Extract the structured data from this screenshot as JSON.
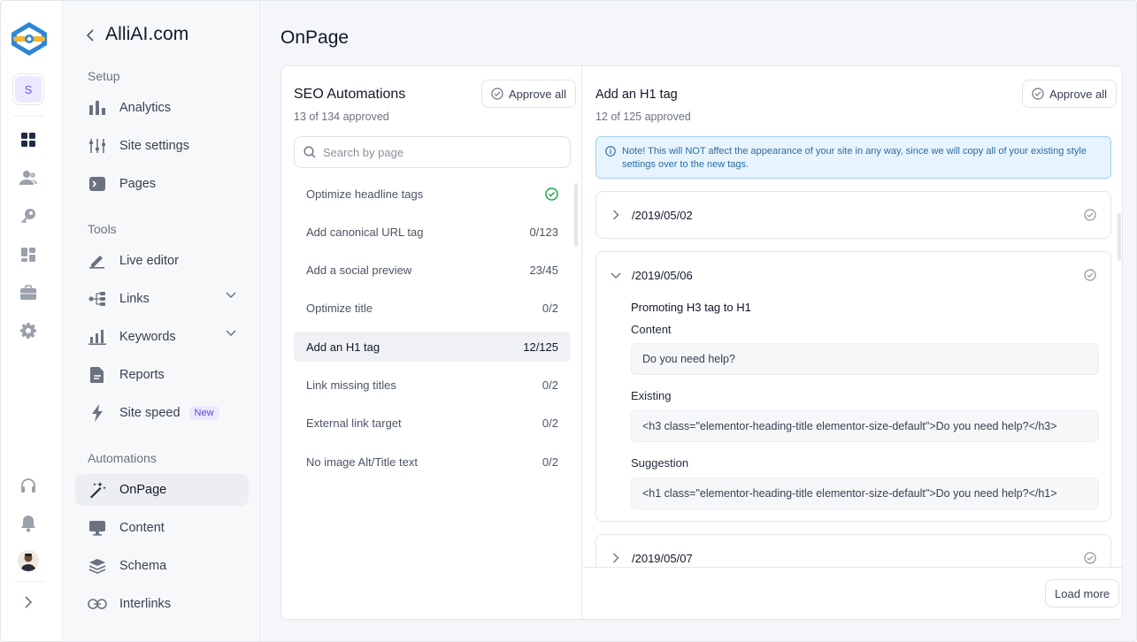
{
  "rail": {
    "site_initial": "S",
    "icons": [
      "dashboard-icon",
      "users-icon",
      "key-icon",
      "widgets-icon",
      "briefcase-icon",
      "gear-icon",
      "headphones-icon",
      "bell-icon",
      "avatar",
      "expand-icon"
    ]
  },
  "sidebar": {
    "title": "AlliAI.com",
    "sections": {
      "setup": "Setup",
      "tools": "Tools",
      "automations": "Automations"
    },
    "items": {
      "analytics": "Analytics",
      "site_settings": "Site settings",
      "pages": "Pages",
      "live_editor": "Live editor",
      "links": "Links",
      "keywords": "Keywords",
      "reports": "Reports",
      "site_speed": "Site speed",
      "site_speed_badge": "New",
      "onpage": "OnPage",
      "content": "Content",
      "schema": "Schema",
      "interlinks": "Interlinks"
    }
  },
  "main": {
    "title": "OnPage"
  },
  "left_pane": {
    "title": "SEO Automations",
    "subtitle": "13 of 134 approved",
    "approve_label": "Approve all",
    "search_placeholder": "Search by page",
    "automations": [
      {
        "label": "Optimize headline tags",
        "count": "",
        "done": true
      },
      {
        "label": "Add canonical URL tag",
        "count": "0/123"
      },
      {
        "label": "Add a social preview",
        "count": "23/45"
      },
      {
        "label": "Optimize title",
        "count": "0/2"
      },
      {
        "label": "Add an H1 tag",
        "count": "12/125",
        "active": true
      },
      {
        "label": "Link missing titles",
        "count": "0/2"
      },
      {
        "label": "External link target",
        "count": "0/2"
      },
      {
        "label": "No image Alt/Title text",
        "count": "0/2"
      }
    ]
  },
  "right_pane": {
    "title": "Add an H1 tag",
    "subtitle": "12 of 125 approved",
    "approve_label": "Approve all",
    "note": "Note! This will NOT affect the appearance of your site in any way, since we will copy all of your existing style settings over to the new tags.",
    "entries": [
      {
        "path": "/2019/05/02"
      },
      {
        "path": "/2019/05/06",
        "heading": "Promoting H3 tag to H1",
        "content_label": "Content",
        "content_value": "Do you need help?",
        "existing_label": "Existing",
        "existing_value": "<h3 class=\"elementor-heading-title elementor-size-default\">Do you need help?</h3>",
        "suggestion_label": "Suggestion",
        "suggestion_value": "<h1 class=\"elementor-heading-title elementor-size-default\">Do you need help?</h1>"
      },
      {
        "path": "/2019/05/07"
      }
    ],
    "load_more": "Load more"
  },
  "colors": {
    "accent": "#5b4bc4",
    "success": "#16a34a",
    "info_bg": "#e8f4fd",
    "info_border": "#9fd0f2"
  }
}
